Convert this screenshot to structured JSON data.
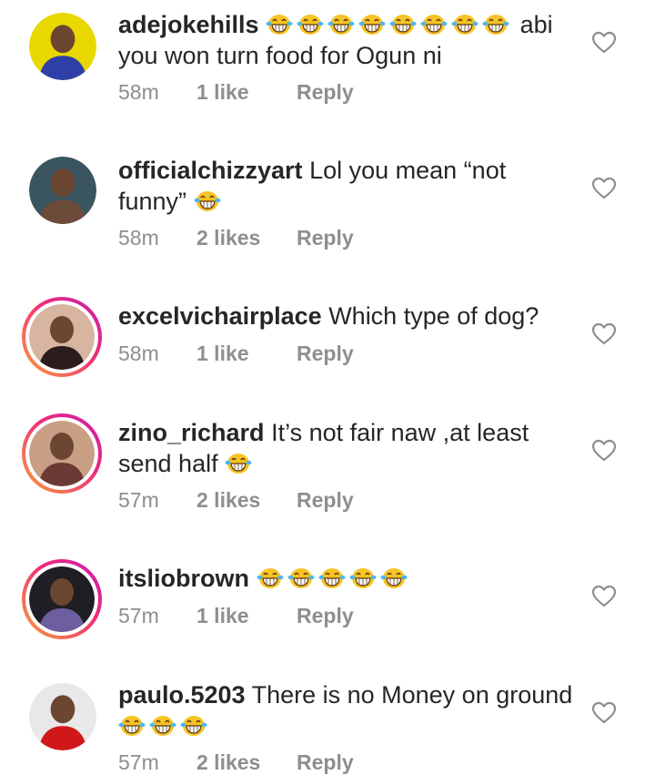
{
  "comments": [
    {
      "username": "adejokehills",
      "emoji_before": 8,
      "text": " abi you won turn food for Ogun ni",
      "emoji_after": 0,
      "time": "58m",
      "likes": "1 like",
      "reply": "Reply",
      "story_ring": false,
      "avatar_color": "#e9d700",
      "avatar_accent": "#2e3fa8"
    },
    {
      "username": "officialchizzyart",
      "emoji_before": 0,
      "text": " Lol you mean “not funny”",
      "emoji_after": 1,
      "time": "58m",
      "likes": "2 likes",
      "reply": "Reply",
      "story_ring": false,
      "avatar_color": "#3a5560",
      "avatar_accent": "#6b4a3a"
    },
    {
      "username": "excelvichairplace",
      "emoji_before": 0,
      "text": " Which type of dog?",
      "emoji_after": 0,
      "time": "58m",
      "likes": "1 like",
      "reply": "Reply",
      "story_ring": true,
      "avatar_color": "#d8b5a0",
      "avatar_accent": "#2b1d1d"
    },
    {
      "username": "zino_richard",
      "emoji_before": 0,
      "text": " It’s not fair naw ,at least send half",
      "emoji_after": 1,
      "time": "57m",
      "likes": "2 likes",
      "reply": "Reply",
      "story_ring": true,
      "avatar_color": "#c9a085",
      "avatar_accent": "#6b3a35"
    },
    {
      "username": "itsliobrown",
      "emoji_before": 5,
      "text": "",
      "emoji_after": 0,
      "time": "57m",
      "likes": "1 like",
      "reply": "Reply",
      "story_ring": true,
      "avatar_color": "#1e1e24",
      "avatar_accent": "#6c5ea0"
    },
    {
      "username": "paulo.5203",
      "emoji_before": 0,
      "text": " There is no Money on ground",
      "emoji_after": 3,
      "time": "57m",
      "likes": "2 likes",
      "reply": "Reply",
      "story_ring": false,
      "avatar_color": "#e8e8e8",
      "avatar_accent": "#d01818"
    }
  ]
}
